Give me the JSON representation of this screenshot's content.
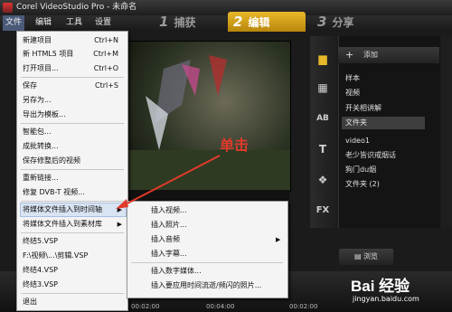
{
  "window": {
    "title": "Corel VideoStudio Pro - 未命名"
  },
  "menubar": {
    "items": [
      "文件",
      "编辑",
      "工具",
      "设置"
    ]
  },
  "steps": [
    {
      "num": "1",
      "label": "捕获"
    },
    {
      "num": "2",
      "label": "编辑"
    },
    {
      "num": "3",
      "label": "分享"
    }
  ],
  "file_menu": {
    "items": [
      {
        "label": "新建项目",
        "shortcut": "Ctrl+N"
      },
      {
        "label": "新 HTML5 项目",
        "shortcut": "Ctrl+M"
      },
      {
        "label": "打开项目...",
        "shortcut": "Ctrl+O"
      },
      {
        "label": "保存",
        "shortcut": "Ctrl+S"
      },
      {
        "label": "另存为...",
        "shortcut": ""
      },
      {
        "label": "导出为模板...",
        "shortcut": ""
      },
      {
        "label": "智能包...",
        "shortcut": ""
      },
      {
        "label": "成批转换...",
        "shortcut": ""
      },
      {
        "label": "保存修整后的视频",
        "shortcut": ""
      },
      {
        "label": "重新链接...",
        "shortcut": ""
      },
      {
        "label": "修复 DVB-T 视频...",
        "shortcut": ""
      },
      {
        "label": "将媒体文件插入到时间轴",
        "shortcut": ""
      },
      {
        "label": "将媒体文件插入到素材库",
        "shortcut": ""
      },
      {
        "label": "终结5.VSP",
        "shortcut": ""
      },
      {
        "label": "F:\\视频\\...\\剪辑.VSP",
        "shortcut": ""
      },
      {
        "label": "终结4.VSP",
        "shortcut": ""
      },
      {
        "label": "终结3.VSP",
        "shortcut": ""
      },
      {
        "label": "退出",
        "shortcut": ""
      }
    ]
  },
  "submenu": {
    "items": [
      "插入视频...",
      "插入照片...",
      "插入音频",
      "插入字幕...",
      "插入数字媒体...",
      "插入要应用时间流逝/频闪的照片..."
    ]
  },
  "annotation": {
    "text": "单击"
  },
  "library": {
    "add_label": "添加",
    "items": [
      "样本",
      "视频",
      "开关相讲解",
      "文件夹",
      "video1",
      "老少皆识戒烟话",
      "狗门du烟",
      "文件夹 (2)"
    ],
    "selected": "文件夹",
    "browse_label": "浏览"
  },
  "side_icons": [
    "fx-label"
  ],
  "side_fx_text": "FX",
  "side_ab_text": "AB",
  "side_t_text": "T",
  "timeline": {
    "times": [
      "00:02:00",
      "00:04:00",
      "00:02:00"
    ]
  },
  "watermark": {
    "text": "Bai 经验",
    "sub": "jingyan.baidu.com"
  },
  "colors": {
    "accent": "#e8b82a",
    "annotation": "#e23a2a",
    "menu_bg": "#f4f4f4"
  }
}
